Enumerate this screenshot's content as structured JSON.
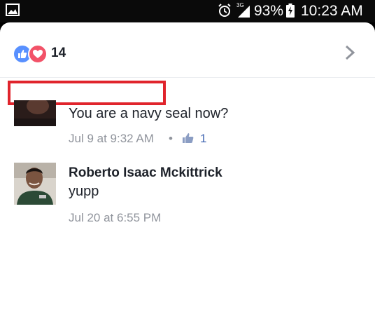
{
  "status_bar": {
    "icons": [
      "gallery-icon",
      "alarm-icon",
      "signal-3g-icon",
      "battery-charging-icon"
    ],
    "network": "3G",
    "battery": "93%",
    "time": "10:23 AM"
  },
  "reactions": {
    "icons": [
      "like-icon",
      "love-icon"
    ],
    "count": "14"
  },
  "comments": [
    {
      "author": "",
      "text": "You are a navy seal now?",
      "time": "Jul 9 at 9:32 AM",
      "likes": "1"
    },
    {
      "author": "Roberto Isaac Mckittrick",
      "text": "yupp",
      "time": "Jul 20 at 6:55 PM"
    }
  ],
  "colors": {
    "like_blue": "#5890ff",
    "love_red": "#f25268",
    "redaction_border": "#e0242c",
    "meta_gray": "#90949c",
    "link_blue": "#4267b2"
  }
}
